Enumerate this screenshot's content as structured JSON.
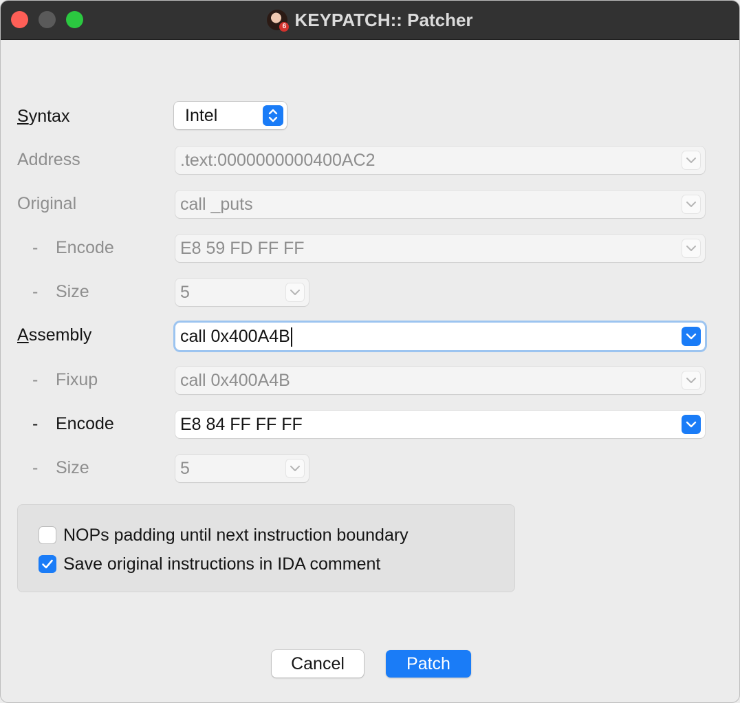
{
  "window": {
    "title": "KEYPATCH:: Patcher",
    "app_icon_badge": "6"
  },
  "form": {
    "syntax": {
      "label_underlined": "S",
      "label_rest": "yntax",
      "value": "Intel"
    },
    "address": {
      "label": "Address",
      "value": ".text:0000000000400AC2"
    },
    "original": {
      "label": "Original",
      "value": "call _puts"
    },
    "original_encode": {
      "dash": "-",
      "label": "Encode",
      "value": "E8 59 FD FF FF"
    },
    "original_size": {
      "dash": "-",
      "label": "Size",
      "value": "5"
    },
    "assembly": {
      "label_underlined": "A",
      "label_rest": "ssembly",
      "value": "call 0x400A4B"
    },
    "fixup": {
      "dash": "-",
      "label": "Fixup",
      "value": "call 0x400A4B"
    },
    "new_encode": {
      "dash": "-",
      "label": "Encode",
      "value": "E8 84 FF FF FF"
    },
    "new_size": {
      "dash": "-",
      "label": "Size",
      "value": "5"
    }
  },
  "options": [
    {
      "label": "NOPs padding until next instruction boundary",
      "checked": false
    },
    {
      "label": "Save original instructions in IDA comment",
      "checked": true
    }
  ],
  "buttons": {
    "cancel": "Cancel",
    "patch": "Patch"
  },
  "colors": {
    "accent": "#1a7cf7",
    "close": "#fe5f57",
    "maximize": "#2bc840"
  }
}
